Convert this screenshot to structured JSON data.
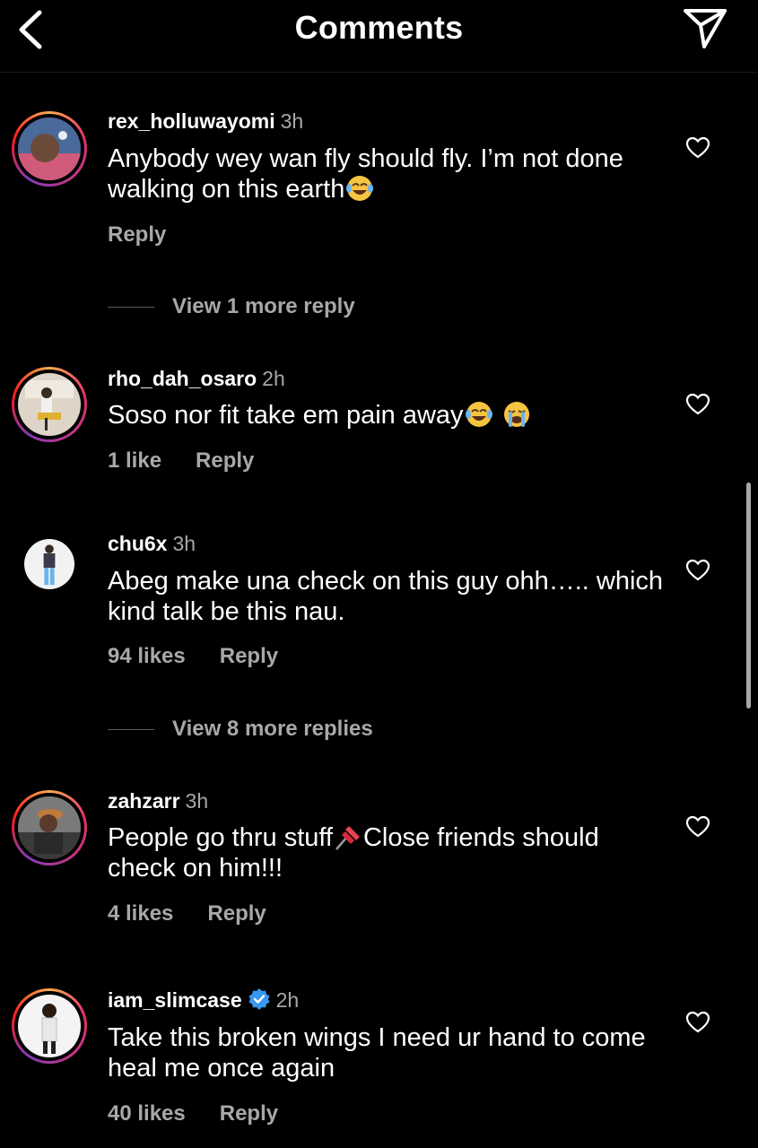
{
  "header": {
    "title": "Comments"
  },
  "comments": [
    {
      "username": "rex_holluwayomi",
      "time": "3h",
      "text": "Anybody wey wan fly should fly. I’m not done walking on this earth",
      "likes": "",
      "reply": "Reply"
    },
    {
      "username": "rho_dah_osaro",
      "time": "2h",
      "text": "Soso nor fit take em pain away",
      "likes": "1 like",
      "reply": "Reply"
    },
    {
      "username": "chu6x",
      "time": "3h",
      "text": "Abeg make una check on this guy ohh….. which kind talk be this nau.",
      "likes": "94 likes",
      "reply": "Reply"
    },
    {
      "username": "zahzarr",
      "time": "3h",
      "text_before": "People go thru stuff",
      "text_after": "Close friends should check on him!!!",
      "likes": "4 likes",
      "reply": "Reply"
    },
    {
      "username": "iam_slimcase",
      "time": "2h",
      "verified": true,
      "text": "Take this broken wings I need ur hand to come heal me once again",
      "likes": "40 likes",
      "reply": "Reply"
    }
  ],
  "view_more": [
    "View 1 more reply",
    "View 8 more replies"
  ],
  "colors": {
    "background": "#000000",
    "muted": "#a8a8a8",
    "verified": "#3897f0"
  },
  "icons": [
    "back-arrow-icon",
    "send-icon",
    "heart-outline-icon",
    "verified-badge-icon",
    "laughing-emoji",
    "crying-emoji",
    "pushpin-emoji"
  ]
}
